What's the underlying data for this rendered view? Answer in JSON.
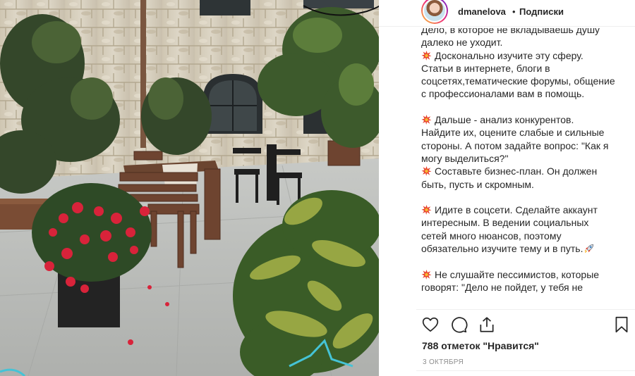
{
  "post": {
    "username": "dmanelova",
    "separator": "•",
    "follow_status": "Подписки"
  },
  "caption": {
    "lines": [
      {
        "type": "text",
        "text": "Дело, в которое не вкладываешь душу"
      },
      {
        "type": "text",
        "text": "далеко не уходит."
      },
      {
        "type": "emoji",
        "text": "Досконально изучите эту сферу."
      },
      {
        "type": "text",
        "text": "Статьи в интернете, блоги в"
      },
      {
        "type": "text",
        "text": "соцсетях,тематические форумы, общение"
      },
      {
        "type": "text",
        "text": "с профессионалами вам в помощь."
      },
      {
        "type": "gap",
        "text": ""
      },
      {
        "type": "emoji",
        "text": "Дальше - анализ конкурентов."
      },
      {
        "type": "text",
        "text": "Найдите их, оцените слабые и сильные"
      },
      {
        "type": "text",
        "text": "стороны. А потом задайте вопрос: \"Как я"
      },
      {
        "type": "text",
        "text": "могу выделиться?\""
      },
      {
        "type": "emoji",
        "text": "Составьте бизнес-план. Он должен"
      },
      {
        "type": "text",
        "text": "быть, пусть и скромным."
      },
      {
        "type": "gap",
        "text": ""
      },
      {
        "type": "emoji",
        "text": "Идите в соцсети. Сделайте аккаунт"
      },
      {
        "type": "text",
        "text": "интересным. В ведении социальных"
      },
      {
        "type": "text",
        "text": "сетей много нюансов, поэтому"
      },
      {
        "type": "rocket",
        "text": "обязательно изучите тему и в путь."
      },
      {
        "type": "gap",
        "text": ""
      },
      {
        "type": "emoji",
        "text": "Не слушайте пессимистов, которые"
      },
      {
        "type": "text",
        "text": "говорят: \"Дело не пойдет, у тебя не"
      }
    ]
  },
  "actions": {
    "like_icon": "heart-icon",
    "comment_icon": "comment-icon",
    "share_icon": "share-icon",
    "save_icon": "bookmark-icon"
  },
  "likes_text": "788 отметок \"Нравится\"",
  "date_text": "3 ОКТЯБРЯ",
  "colors": {
    "text": "#262626",
    "muted": "#8e8e8e",
    "divider": "#efefef",
    "emoji_red": "#e8412c"
  }
}
